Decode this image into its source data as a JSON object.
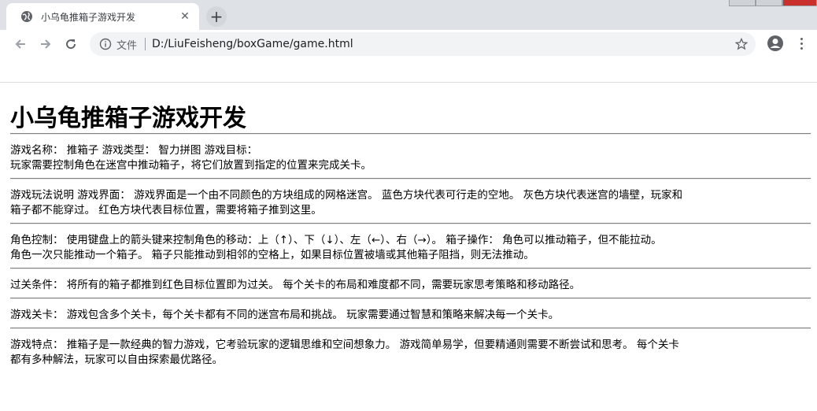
{
  "browser": {
    "tab_title": "小乌龟推箱子游戏开发",
    "new_tab_symbol": "+",
    "tab_close_symbol": "✕",
    "url_scheme_label": "文件",
    "url": "D:/LiuFeisheng/boxGame/game.html"
  },
  "page": {
    "title": "小乌龟推箱子游戏开发",
    "sections": [
      {
        "line1": "游戏名称： 推箱子 游戏类型： 智力拼图 游戏目标：",
        "line2": "玩家需要控制角色在迷宫中推动箱子，将它们放置到指定的位置来完成关卡。"
      },
      {
        "line1": "游戏玩法说明 游戏界面： 游戏界面是一个由不同颜色的方块组成的网格迷宫。 蓝色方块代表可行走的空地。 灰色方块代表迷宫的墙壁，玩家和",
        "line2": "箱子都不能穿过。 红色方块代表目标位置，需要将箱子推到这里。"
      },
      {
        "line1": "角色控制： 使用键盘上的箭头键来控制角色的移动：上（↑）、下（↓）、左（←）、右（→）。 箱子操作： 角色可以推动箱子，但不能拉动。",
        "line2": "角色一次只能推动一个箱子。 箱子只能推动到相邻的空格上，如果目标位置被墙或其他箱子阻挡，则无法推动。"
      },
      {
        "line1": "过关条件： 将所有的箱子都推到红色目标位置即为过关。 每个关卡的布局和难度都不同，需要玩家思考策略和移动路径。",
        "line2": ""
      },
      {
        "line1": "游戏关卡： 游戏包含多个关卡，每个关卡都有不同的迷宫布局和挑战。 玩家需要通过智慧和策略来解决每一个关卡。",
        "line2": ""
      },
      {
        "line1": "游戏特点： 推箱子是一款经典的智力游戏，它考验玩家的逻辑思维和空间想象力。 游戏简单易学，但要精通则需要不断尝试和思考。 每个关卡",
        "line2": "都有多种解法，玩家可以自由探索最优路径。"
      }
    ]
  },
  "colors": {
    "tabstrip": "#dee1e6",
    "omnibox": "#f1f3f4",
    "rule": "#808080"
  }
}
